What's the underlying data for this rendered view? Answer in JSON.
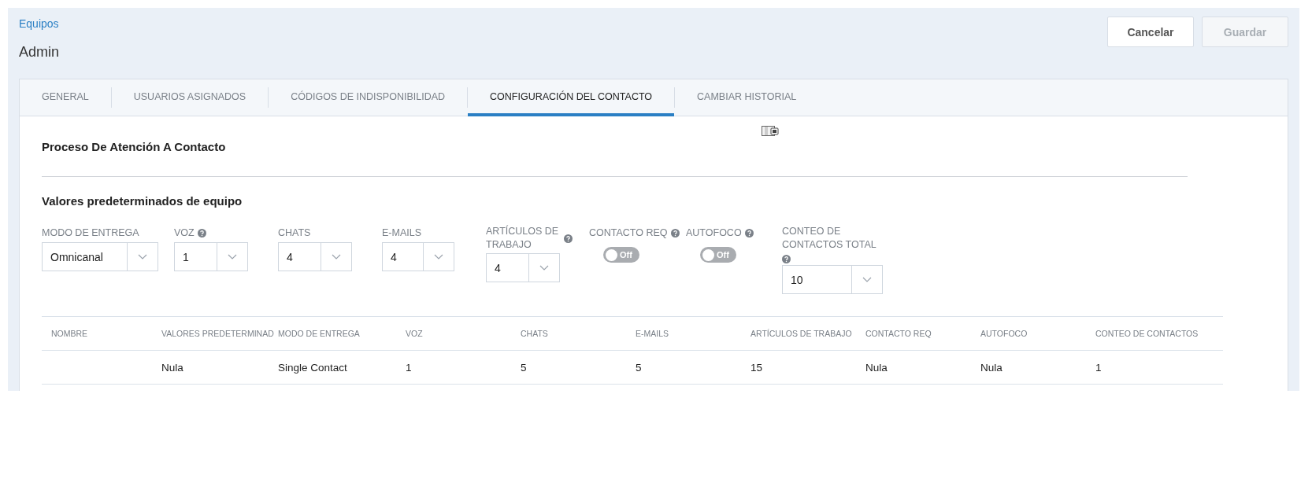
{
  "breadcrumb": "Equipos",
  "title": "Admin",
  "buttons": [
    {
      "label": "Cancelar",
      "disabled": false
    },
    {
      "label": "Guardar",
      "disabled": true
    }
  ],
  "tabs": [
    {
      "label": "GENERAL",
      "selected": false
    },
    {
      "label": "USUARIOS ASIGNADOS",
      "selected": false
    },
    {
      "label": "CÓDIGOS DE INDISPONIBILIDAD",
      "selected": false
    },
    {
      "label": "CONFIGURACIÓN DEL CONTACTO",
      "selected": true
    },
    {
      "label": "CAMBIAR HISTORIAL",
      "selected": false
    }
  ],
  "section_title": "Proceso De Atención A Contacto",
  "subsection_title": "Valores predeterminados de equipo",
  "fields": [
    {
      "kind": "select",
      "label": "MODO DE ENTREGA",
      "help": false,
      "value": "Omnicanal"
    },
    {
      "kind": "select",
      "label": "VOZ",
      "help": true,
      "value": "1"
    },
    {
      "kind": "select",
      "label": "CHATS",
      "help": false,
      "value": "4"
    },
    {
      "kind": "select",
      "label": "E-MAILS",
      "help": false,
      "value": "4"
    },
    {
      "kind": "select",
      "label": "ARTÍCULOS DE TRABAJO",
      "help": true,
      "value": "4"
    },
    {
      "kind": "toggle",
      "label": "CONTACTO REQ",
      "help": true,
      "on": false,
      "state_label": "Off"
    },
    {
      "kind": "toggle",
      "label": "AUTOFOCO",
      "help": true,
      "on": false,
      "state_label": "Off"
    },
    {
      "kind": "select",
      "label": "CONTEO DE CONTACTOS TOTAL",
      "help": true,
      "value": "10"
    }
  ],
  "table": {
    "columns": [
      "NOMBRE",
      "VALORES PREDETERMINAD",
      "MODO DE ENTREGA",
      "VOZ",
      "CHATS",
      "E-MAILS",
      "ARTÍCULOS DE TRABAJO",
      "CONTACTO REQ",
      "AUTOFOCO",
      "CONTEO DE CONTACTOS"
    ],
    "rows": [
      [
        "",
        "Nula",
        "Single Contact",
        "1",
        "5",
        "5",
        "15",
        "Nula",
        "Nula",
        "1"
      ]
    ]
  }
}
